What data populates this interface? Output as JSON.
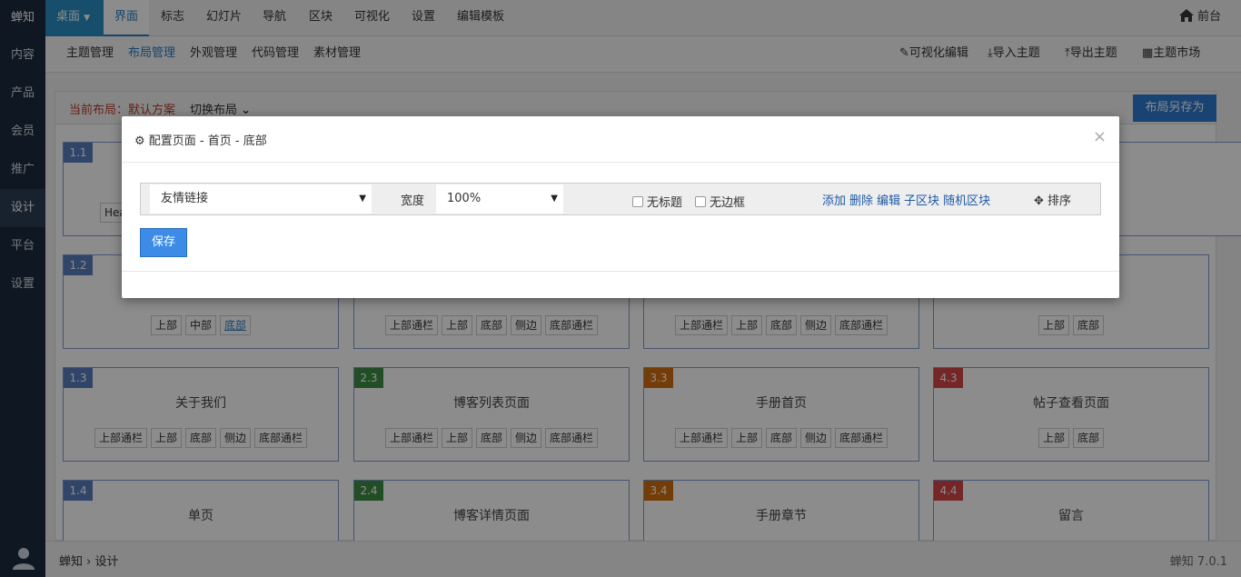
{
  "sidebar": {
    "brand": "蝉知",
    "items": [
      "内容",
      "产品",
      "会员",
      "推广",
      "设计",
      "平台",
      "设置"
    ]
  },
  "topbar": {
    "desktop": "桌面",
    "tabs": [
      "界面",
      "标志",
      "幻灯片",
      "导航",
      "区块",
      "可视化",
      "设置",
      "编辑模板"
    ],
    "front": "前台"
  },
  "subbar": {
    "items": [
      "主题管理",
      "布局管理",
      "外观管理",
      "代码管理",
      "素材管理"
    ],
    "tools": [
      "可视化编辑",
      "导入主题",
      "导出主题",
      "主题市场"
    ]
  },
  "panel": {
    "current": "当前布局：默认方案",
    "switch": "切换布局",
    "save_as": "布局另存为"
  },
  "cards": [
    {
      "badge": "1.1",
      "title": "",
      "chips": [
        "Hea"
      ]
    },
    {
      "badge": "1.2",
      "title": "",
      "chips": [
        "上部",
        "中部",
        "底部"
      ]
    },
    {
      "badge": "",
      "title": "",
      "chips": [
        "上部通栏",
        "上部",
        "底部",
        "侧边",
        "底部通栏"
      ]
    },
    {
      "badge": "",
      "title": "",
      "chips": [
        "上部通栏",
        "上部",
        "底部",
        "侧边",
        "底部通栏"
      ]
    },
    {
      "badge": "",
      "title": "",
      "chips": [
        "上部",
        "底部"
      ]
    },
    {
      "badge": "1.3",
      "title": "关于我们",
      "chips": [
        "上部通栏",
        "上部",
        "底部",
        "侧边",
        "底部通栏"
      ]
    },
    {
      "badge": "2.3",
      "title": "博客列表页面",
      "chips": [
        "上部通栏",
        "上部",
        "底部",
        "侧边",
        "底部通栏"
      ]
    },
    {
      "badge": "3.3",
      "title": "手册首页",
      "chips": [
        "上部通栏",
        "上部",
        "底部",
        "侧边",
        "底部通栏"
      ]
    },
    {
      "badge": "4.3",
      "title": "帖子查看页面",
      "chips": [
        "上部",
        "底部"
      ]
    },
    {
      "badge": "1.4",
      "title": "单页",
      "chips": []
    },
    {
      "badge": "2.4",
      "title": "博客详情页面",
      "chips": []
    },
    {
      "badge": "3.4",
      "title": "手册章节",
      "chips": []
    },
    {
      "badge": "4.4",
      "title": "留言",
      "chips": []
    }
  ],
  "colors": {
    "c1": "#5a7fbf",
    "c2": "#3f8f46",
    "c3": "#d4700e",
    "c4": "#d64545"
  },
  "modal": {
    "title": "配置页面 - 首页 - 底部",
    "close": "×",
    "block_select": "友情链接",
    "width_label": "宽度",
    "width_value": "100%",
    "no_title": "无标题",
    "no_border": "无边框",
    "actions": [
      "添加",
      "删除",
      "编辑",
      "子区块",
      "随机区块"
    ],
    "sort": "排序",
    "save": "保存"
  },
  "bottom": {
    "breadcrumb_root": "蝉知",
    "breadcrumb_sep": "›",
    "breadcrumb_leaf": "设计",
    "version": "蝉知 7.0.1"
  }
}
